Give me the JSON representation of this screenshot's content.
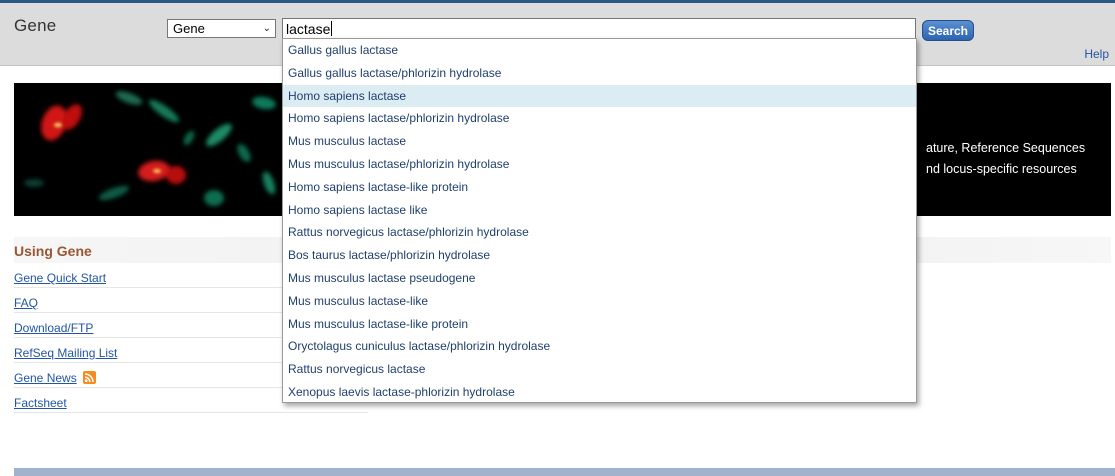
{
  "header": {
    "db_name": "Gene",
    "db_select": {
      "selected": "Gene"
    },
    "search": {
      "value": "lactase"
    },
    "search_button_label": "Search",
    "help_label": "Help"
  },
  "banner": {
    "text_line_1": "ature, Reference Sequences",
    "text_line_2": "nd locus-specific resources"
  },
  "using_gene": {
    "title": "Using Gene",
    "links": [
      {
        "label": "Gene Quick Start"
      },
      {
        "label": "FAQ"
      },
      {
        "label": "Download/FTP"
      },
      {
        "label": "RefSeq Mailing List"
      },
      {
        "label": "Gene News",
        "icon": "rss-icon"
      },
      {
        "label": "Factsheet"
      }
    ]
  },
  "suggestions": {
    "active_index": 2,
    "items": [
      "Gallus gallus lactase",
      "Gallus gallus lactase/phlorizin hydrolase",
      "Homo sapiens lactase",
      "Homo sapiens lactase/phlorizin hydrolase",
      "Mus musculus lactase",
      "Mus musculus lactase/phlorizin hydrolase",
      "Homo sapiens lactase-like protein",
      "Homo sapiens lactase like",
      "Rattus norvegicus lactase/phlorizin hydrolase",
      "Bos taurus lactase/phlorizin hydrolase",
      "Mus musculus lactase pseudogene",
      "Mus musculus lactase-like",
      "Mus musculus lactase-like protein",
      "Oryctolagus cuniculus lactase/phlorizin hydrolase",
      "Rattus norvegicus lactase",
      "Xenopus laevis lactase-phlorizin hydrolase"
    ]
  },
  "colors": {
    "link": "#2255a4",
    "section_title": "#985735",
    "header_bg": "#dcdcdc",
    "top_border": "#2c5886",
    "suggestion_active_bg": "#dcecf3",
    "search_button": "#2d64b0",
    "rss": "#f68b1f"
  }
}
